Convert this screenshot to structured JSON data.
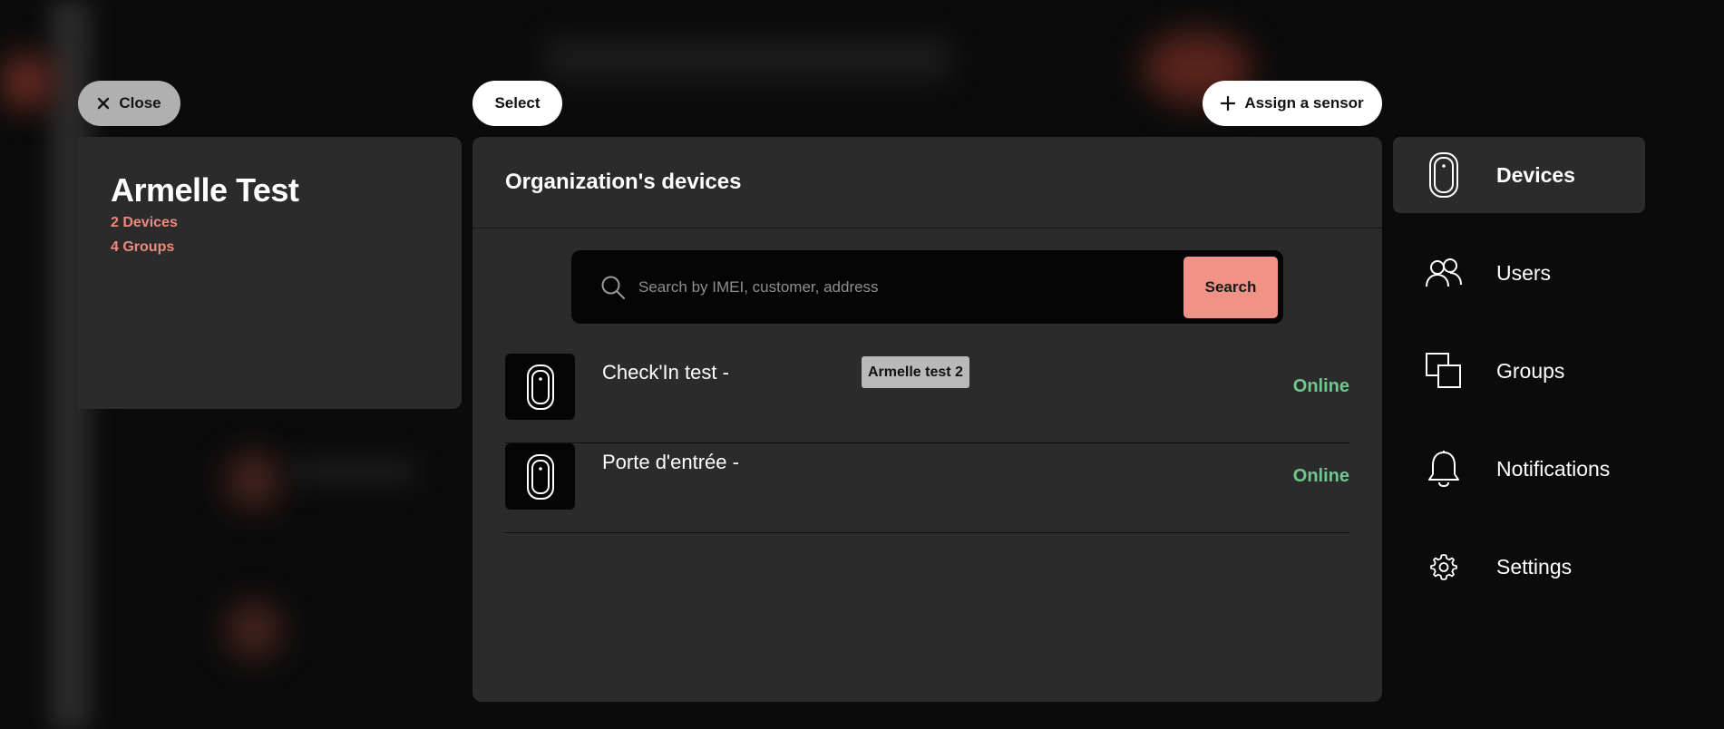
{
  "toolbar": {
    "close_label": "Close",
    "select_label": "Select",
    "assign_label": "Assign a sensor"
  },
  "organization": {
    "name": "Armelle Test",
    "devices_count": "2 Devices",
    "groups_count": "4 Groups"
  },
  "main": {
    "title": "Organization's devices",
    "search": {
      "placeholder": "Search by IMEI, customer, address",
      "value": "",
      "button_label": "Search"
    },
    "devices": [
      {
        "name": "Check'In test -",
        "tag": "Armelle test 2",
        "status": "Online"
      },
      {
        "name": "Porte d'entrée -",
        "tag": "",
        "status": "Online"
      }
    ]
  },
  "nav": {
    "items": [
      {
        "label": "Devices",
        "icon": "device-icon",
        "active": true
      },
      {
        "label": "Users",
        "icon": "users-icon",
        "active": false
      },
      {
        "label": "Groups",
        "icon": "groups-icon",
        "active": false
      },
      {
        "label": "Notifications",
        "icon": "bell-icon",
        "active": false
      },
      {
        "label": "Settings",
        "icon": "gear-icon",
        "active": false
      }
    ]
  },
  "colors": {
    "accent": "#f09386",
    "stat_text": "#ec8a7d",
    "online": "#6fc790",
    "panel": "#2b2b2b",
    "background": "#0b0b0b"
  }
}
